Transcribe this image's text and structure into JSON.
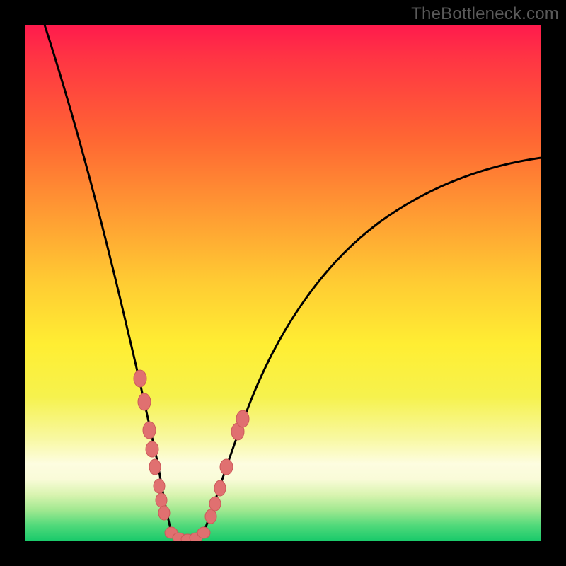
{
  "watermark": "TheBottleneck.com",
  "colors": {
    "background": "#000000",
    "gradient_top": "#ff1a4d",
    "gradient_bottom": "#18c96a",
    "curve_stroke": "#000000",
    "dot_fill": "#e06f6f",
    "dot_stroke": "#c24848"
  },
  "chart_data": {
    "type": "line",
    "title": "",
    "xlabel": "",
    "ylabel": "",
    "xlim": [
      0,
      100
    ],
    "ylim": [
      0,
      100
    ],
    "grid": false,
    "legend": false,
    "annotations": [
      "TheBottleneck.com"
    ],
    "series": [
      {
        "name": "left-branch",
        "x": [
          4,
          8,
          12,
          16,
          18,
          20,
          22,
          23,
          24,
          25,
          26,
          27
        ],
        "y": [
          100,
          78,
          58,
          40,
          32,
          24,
          15,
          10,
          6,
          3,
          1.5,
          0.5
        ]
      },
      {
        "name": "valley",
        "x": [
          27,
          28,
          29,
          30,
          31,
          32,
          33
        ],
        "y": [
          0.5,
          0.2,
          0.1,
          0.1,
          0.1,
          0.2,
          0.5
        ]
      },
      {
        "name": "right-branch",
        "x": [
          33,
          35,
          38,
          42,
          48,
          56,
          66,
          78,
          90,
          100
        ],
        "y": [
          0.5,
          4,
          12,
          22,
          34,
          46,
          56,
          64,
          70,
          74
        ]
      }
    ],
    "points": [
      {
        "name": "left-dot",
        "x": 21.5,
        "y": 30.5
      },
      {
        "name": "left-dot",
        "x": 22.2,
        "y": 26.0
      },
      {
        "name": "left-dot",
        "x": 23.2,
        "y": 20.5
      },
      {
        "name": "left-dot",
        "x": 23.8,
        "y": 17.0
      },
      {
        "name": "left-dot",
        "x": 24.4,
        "y": 13.5
      },
      {
        "name": "left-dot",
        "x": 25.4,
        "y": 9.5
      },
      {
        "name": "left-dot",
        "x": 25.6,
        "y": 7.5
      },
      {
        "name": "left-dot",
        "x": 26.0,
        "y": 5.0
      },
      {
        "name": "valley-dot",
        "x": 27.5,
        "y": 1.2
      },
      {
        "name": "valley-dot",
        "x": 29.0,
        "y": 0.6
      },
      {
        "name": "valley-dot",
        "x": 30.5,
        "y": 0.5
      },
      {
        "name": "valley-dot",
        "x": 32.0,
        "y": 0.7
      },
      {
        "name": "valley-dot",
        "x": 33.5,
        "y": 1.4
      },
      {
        "name": "right-dot",
        "x": 35.0,
        "y": 4.5
      },
      {
        "name": "right-dot",
        "x": 35.8,
        "y": 7.0
      },
      {
        "name": "right-dot",
        "x": 36.8,
        "y": 10.0
      },
      {
        "name": "right-dot",
        "x": 38.0,
        "y": 14.0
      },
      {
        "name": "right-dot",
        "x": 40.5,
        "y": 21.0
      },
      {
        "name": "right-dot",
        "x": 41.5,
        "y": 23.5
      }
    ]
  }
}
